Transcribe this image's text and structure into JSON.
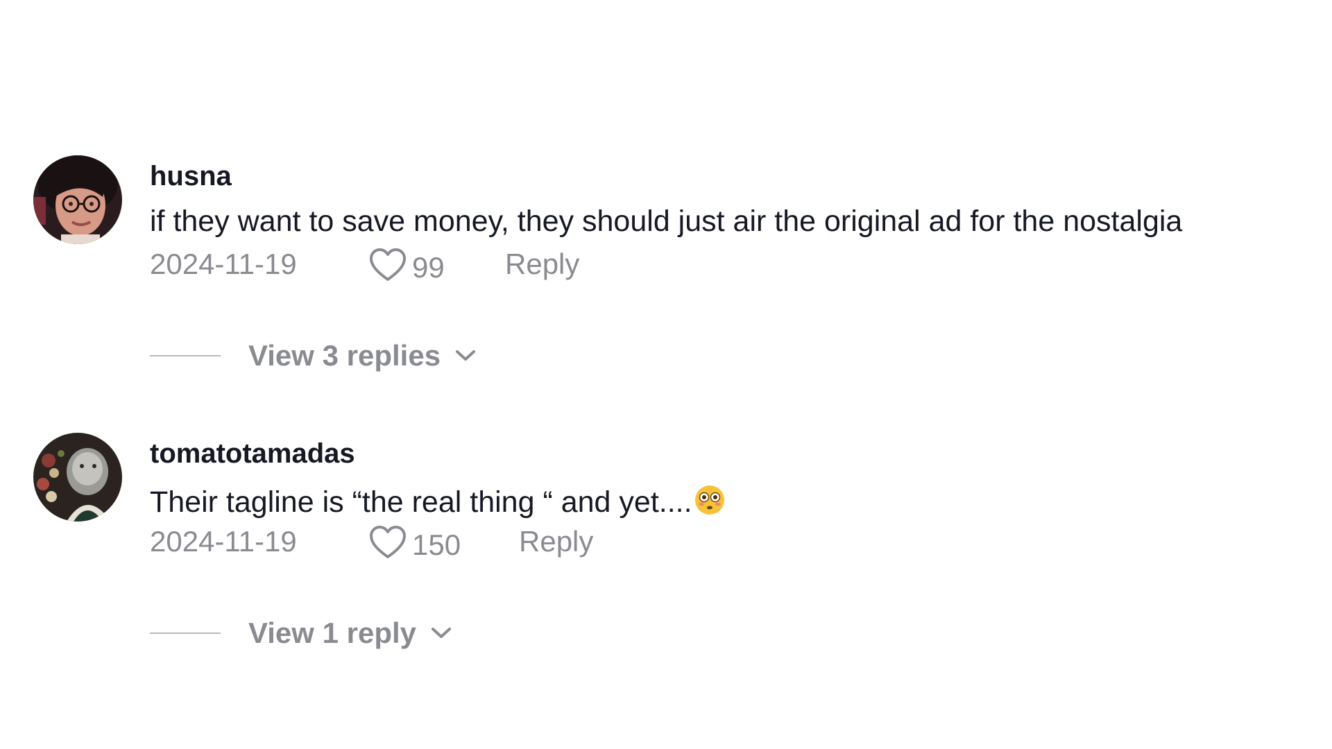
{
  "comments": [
    {
      "username": "husna",
      "text": "if they want to save money, they should just air the original ad for the nostalgia",
      "emoji": "",
      "date": "2024-11-19",
      "likes": "99",
      "reply_label": "Reply",
      "view_replies_label": "View 3 replies",
      "avatar": "avatar-woman-glasses"
    },
    {
      "username": "tomatotamadas",
      "text": "Their tagline is “the real thing “ and yet....",
      "emoji": "😳",
      "date": "2024-11-19",
      "likes": "150",
      "reply_label": "Reply",
      "view_replies_label": "View 1 reply",
      "avatar": "avatar-painting-portrait"
    }
  ],
  "colors": {
    "primary_text": "#161823",
    "secondary_text": "#8a8b91",
    "divider": "#b8b9bd",
    "background": "#ffffff"
  },
  "icons": {
    "like": "heart-outline-icon",
    "expand": "chevron-down-icon"
  }
}
